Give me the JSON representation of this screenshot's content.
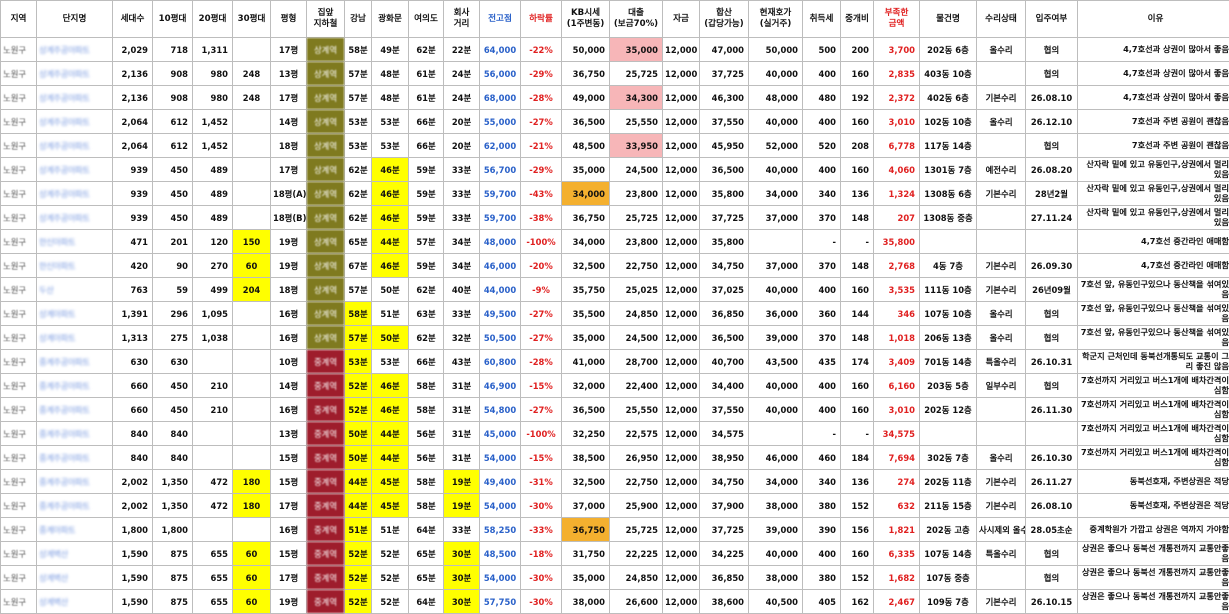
{
  "headers": [
    "지역",
    "단지명",
    "세대수",
    "10평대",
    "20평대",
    "30평대",
    "평형",
    "집앞\n지하철",
    "강남",
    "광화문",
    "여의도",
    "회사\n거리",
    "전고점",
    "하락률",
    "KB시세\n(1주변동)",
    "대출\n(보금70%)",
    "자금",
    "합산\n(갑당가능)",
    "현재호가\n(실거주)",
    "취득세",
    "중개비",
    "부족한\n금액",
    "물건명",
    "수리상태",
    "입주여부",
    "이유"
  ],
  "colors": {
    "yellow": "#ffff00",
    "pink": "#f7b6b8",
    "orange": "#f4b02f",
    "olive": "#7f7a1f",
    "maroon": "#9e1d2c",
    "blue": "#2a61c9",
    "red": "#e02020"
  },
  "rows": [
    {
      "region": "노원구",
      "name": "상계주공아파트",
      "households": "2,029",
      "p10": "718",
      "p20": "1,311",
      "p30": "",
      "size": "17평",
      "station": "상계역",
      "stationColor": "olive",
      "gangnam": "58분",
      "ghm": "49분",
      "ydo": "62분",
      "company": "22분",
      "peak": "64,000",
      "drop": "-22%",
      "kb": "50,000",
      "loan": "35,000",
      "fund": "12,000",
      "sum": "47,000",
      "ask": "50,000",
      "tax": "500",
      "fee": "200",
      "lack": "3,700",
      "item": "202동 6층",
      "repair": "올수리",
      "movein": "협의",
      "reason": "4,7호선과 상권이 많아서 좋음",
      "hl": {
        "loan": "pink"
      }
    },
    {
      "region": "노원구",
      "name": "상계주공아파트",
      "households": "2,136",
      "p10": "908",
      "p20": "980",
      "p30": "248",
      "size": "13평",
      "station": "상계역",
      "stationColor": "olive",
      "gangnam": "57분",
      "ghm": "48분",
      "ydo": "61분",
      "company": "24분",
      "peak": "56,000",
      "drop": "-29%",
      "kb": "36,750",
      "loan": "25,725",
      "fund": "12,000",
      "sum": "37,725",
      "ask": "40,000",
      "tax": "400",
      "fee": "160",
      "lack": "2,835",
      "item": "403동 10층",
      "repair": "",
      "movein": "협의",
      "reason": "4,7호선과 상권이 많아서 좋음",
      "hl": {}
    },
    {
      "region": "노원구",
      "name": "상계주공아파트",
      "households": "2,136",
      "p10": "908",
      "p20": "980",
      "p30": "248",
      "size": "17평",
      "station": "상계역",
      "stationColor": "olive",
      "gangnam": "57분",
      "ghm": "48분",
      "ydo": "61분",
      "company": "24분",
      "peak": "68,000",
      "drop": "-28%",
      "kb": "49,000",
      "loan": "34,300",
      "fund": "12,000",
      "sum": "46,300",
      "ask": "48,000",
      "tax": "480",
      "fee": "192",
      "lack": "2,372",
      "item": "402동 6층",
      "repair": "기본수리",
      "movein": "26.08.10",
      "reason": "4,7호선과 상권이 많아서 좋음",
      "hl": {
        "loan": "pink"
      }
    },
    {
      "region": "노원구",
      "name": "상계주공아파트",
      "households": "2,064",
      "p10": "612",
      "p20": "1,452",
      "p30": "",
      "size": "14평",
      "station": "상계역",
      "stationColor": "olive",
      "gangnam": "53분",
      "ghm": "53분",
      "ydo": "66분",
      "company": "20분",
      "peak": "55,000",
      "drop": "-27%",
      "kb": "36,500",
      "loan": "25,550",
      "fund": "12,000",
      "sum": "37,550",
      "ask": "40,000",
      "tax": "400",
      "fee": "160",
      "lack": "3,010",
      "item": "102동 10층",
      "repair": "올수리",
      "movein": "26.12.10",
      "reason": "7호선과 주변 공원이 괜찮음",
      "hl": {}
    },
    {
      "region": "노원구",
      "name": "상계주공아파트",
      "households": "2,064",
      "p10": "612",
      "p20": "1,452",
      "p30": "",
      "size": "18평",
      "station": "상계역",
      "stationColor": "olive",
      "gangnam": "53분",
      "ghm": "53분",
      "ydo": "66분",
      "company": "20분",
      "peak": "62,000",
      "drop": "-21%",
      "kb": "48,500",
      "loan": "33,950",
      "fund": "12,000",
      "sum": "45,950",
      "ask": "52,000",
      "tax": "520",
      "fee": "208",
      "lack": "6,778",
      "item": "117동 14층",
      "repair": "",
      "movein": "협의",
      "reason": "7호선과 주변 공원이 괜찮음",
      "hl": {
        "loan": "pink"
      }
    },
    {
      "region": "노원구",
      "name": "상계주공아파트",
      "households": "939",
      "p10": "450",
      "p20": "489",
      "p30": "",
      "size": "17평",
      "station": "상계역",
      "stationColor": "olive",
      "gangnam": "62분",
      "ghm": "46분",
      "ydo": "59분",
      "company": "33분",
      "peak": "56,700",
      "drop": "-29%",
      "kb": "35,000",
      "loan": "24,500",
      "fund": "12,000",
      "sum": "36,500",
      "ask": "40,000",
      "tax": "400",
      "fee": "160",
      "lack": "4,060",
      "item": "1301동 7층",
      "repair": "예전수리",
      "movein": "26.08.20",
      "reason": "산자락 밑에 있고 유동인구,상권에서 멀리있음",
      "hl": {
        "ghm": "yellow"
      }
    },
    {
      "region": "노원구",
      "name": "상계주공아파트",
      "households": "939",
      "p10": "450",
      "p20": "489",
      "p30": "",
      "size": "18평(A)",
      "station": "상계역",
      "stationColor": "olive",
      "gangnam": "62분",
      "ghm": "46분",
      "ydo": "59분",
      "company": "33분",
      "peak": "59,700",
      "drop": "-43%",
      "kb": "34,000",
      "loan": "23,800",
      "fund": "12,000",
      "sum": "35,800",
      "ask": "34,000",
      "tax": "340",
      "fee": "136",
      "lack": "1,324",
      "item": "1308동 6층",
      "repair": "기본수리",
      "movein": "28년2월",
      "reason": "산자락 밑에 있고 유동인구,상권에서 멀리있음",
      "hl": {
        "ghm": "yellow",
        "kb": "orange"
      }
    },
    {
      "region": "노원구",
      "name": "상계주공아파트",
      "households": "939",
      "p10": "450",
      "p20": "489",
      "p30": "",
      "size": "18평(B)",
      "station": "상계역",
      "stationColor": "olive",
      "gangnam": "62분",
      "ghm": "46분",
      "ydo": "59분",
      "company": "33분",
      "peak": "59,700",
      "drop": "-38%",
      "kb": "36,750",
      "loan": "25,725",
      "fund": "12,000",
      "sum": "37,725",
      "ask": "37,000",
      "tax": "370",
      "fee": "148",
      "lack": "207",
      "item": "1308동 중층",
      "repair": "",
      "movein": "27.11.24",
      "reason": "산자락 밑에 있고 유동인구,상권에서 멀리있음",
      "hl": {
        "ghm": "yellow"
      }
    },
    {
      "region": "노원구",
      "name": "한신아파트",
      "households": "471",
      "p10": "201",
      "p20": "120",
      "p30": "150",
      "size": "19평",
      "station": "상계역",
      "stationColor": "olive",
      "gangnam": "65분",
      "ghm": "44분",
      "ydo": "57분",
      "company": "34분",
      "peak": "48,000",
      "drop": "-100%",
      "kb": "34,000",
      "loan": "23,800",
      "fund": "12,000",
      "sum": "35,800",
      "ask": "",
      "tax": "-",
      "fee": "-",
      "lack": "35,800",
      "item": "",
      "repair": "",
      "movein": "",
      "reason": "4,7호선 중간라인 애매함",
      "hl": {
        "p30": "yellow",
        "ghm": "yellow"
      }
    },
    {
      "region": "노원구",
      "name": "한신아파트",
      "households": "420",
      "p10": "90",
      "p20": "270",
      "p30": "60",
      "size": "19평",
      "station": "상계역",
      "stationColor": "olive",
      "gangnam": "67분",
      "ghm": "46분",
      "ydo": "59분",
      "company": "34분",
      "peak": "46,000",
      "drop": "-20%",
      "kb": "32,500",
      "loan": "22,750",
      "fund": "12,000",
      "sum": "34,750",
      "ask": "37,000",
      "tax": "370",
      "fee": "148",
      "lack": "2,768",
      "item": "4동 7층",
      "repair": "기본수리",
      "movein": "26.09.30",
      "reason": "4,7호선 중간라인 애매함",
      "hl": {
        "p30": "yellow",
        "ghm": "yellow"
      }
    },
    {
      "region": "노원구",
      "name": "두산",
      "households": "763",
      "p10": "59",
      "p20": "499",
      "p30": "204",
      "size": "18평",
      "station": "상계역",
      "stationColor": "olive",
      "gangnam": "57분",
      "ghm": "50분",
      "ydo": "62분",
      "company": "40분",
      "peak": "44,000",
      "drop": "-9%",
      "kb": "35,750",
      "loan": "25,025",
      "fund": "12,000",
      "sum": "37,025",
      "ask": "40,000",
      "tax": "400",
      "fee": "160",
      "lack": "3,535",
      "item": "111동 10층",
      "repair": "기본수리",
      "movein": "26년09월",
      "reason": "7호선 앞, 유동인구있으나 동산책을 섞여있음",
      "hl": {
        "p30": "yellow"
      }
    },
    {
      "region": "노원구",
      "name": "상계아파트",
      "households": "1,391",
      "p10": "296",
      "p20": "1,095",
      "p30": "",
      "size": "16평",
      "station": "상계역",
      "stationColor": "olive",
      "gangnam": "58분",
      "ghm": "51분",
      "ydo": "63분",
      "company": "33분",
      "peak": "49,500",
      "drop": "-27%",
      "kb": "35,500",
      "loan": "24,850",
      "fund": "12,000",
      "sum": "36,850",
      "ask": "36,000",
      "tax": "360",
      "fee": "144",
      "lack": "346",
      "item": "107동 10층",
      "repair": "올수리",
      "movein": "협의",
      "reason": "7호선 앞, 유동인구있으나 동산책을 섞여있음",
      "hl": {
        "gangnam": "yellow"
      }
    },
    {
      "region": "노원구",
      "name": "상계아파트",
      "households": "1,313",
      "p10": "275",
      "p20": "1,038",
      "p30": "",
      "size": "16평",
      "station": "상계역",
      "stationColor": "olive",
      "gangnam": "57분",
      "ghm": "50분",
      "ydo": "62분",
      "company": "32분",
      "peak": "50,500",
      "drop": "-27%",
      "kb": "35,000",
      "loan": "24,500",
      "fund": "12,000",
      "sum": "36,500",
      "ask": "39,000",
      "tax": "370",
      "fee": "148",
      "lack": "1,018",
      "item": "206동 13층",
      "repair": "올수리",
      "movein": "협의",
      "reason": "7호선 앞, 유동인구있으나 동산책을 섞여있음",
      "hl": {
        "gangnam": "yellow",
        "ghm": "yellow"
      }
    },
    {
      "region": "노원구",
      "name": "중계주공아파트",
      "households": "630",
      "p10": "630",
      "p20": "",
      "p30": "",
      "size": "10평",
      "station": "중계역",
      "stationColor": "red",
      "gangnam": "53분",
      "ghm": "53분",
      "ydo": "66분",
      "company": "43분",
      "peak": "60,800",
      "drop": "-28%",
      "kb": "41,000",
      "loan": "28,700",
      "fund": "12,000",
      "sum": "40,700",
      "ask": "43,500",
      "tax": "435",
      "fee": "174",
      "lack": "3,409",
      "item": "701동 14층",
      "repair": "특올수리",
      "movein": "26.10.31",
      "reason": "학군지 근처인데 동북선개통되도 교통이 그리 좋진 않음",
      "hl": {
        "gangnam": "yellow"
      }
    },
    {
      "region": "노원구",
      "name": "중계주공아파트",
      "households": "660",
      "p10": "450",
      "p20": "210",
      "p30": "",
      "size": "14평",
      "station": "중계역",
      "stationColor": "red",
      "gangnam": "52분",
      "ghm": "46분",
      "ydo": "58분",
      "company": "31분",
      "peak": "46,900",
      "drop": "-15%",
      "kb": "32,000",
      "loan": "22,400",
      "fund": "12,000",
      "sum": "34,400",
      "ask": "40,000",
      "tax": "400",
      "fee": "160",
      "lack": "6,160",
      "item": "203동 5층",
      "repair": "일부수리",
      "movein": "협의",
      "reason": "7호선까지 거리있고 버스1개에 배차간격이 심함",
      "hl": {
        "gangnam": "yellow",
        "ghm": "yellow"
      }
    },
    {
      "region": "노원구",
      "name": "중계주공아파트",
      "households": "660",
      "p10": "450",
      "p20": "210",
      "p30": "",
      "size": "16평",
      "station": "중계역",
      "stationColor": "red",
      "gangnam": "52분",
      "ghm": "46분",
      "ydo": "58분",
      "company": "31분",
      "peak": "54,800",
      "drop": "-27%",
      "kb": "36,500",
      "loan": "25,550",
      "fund": "12,000",
      "sum": "37,550",
      "ask": "40,000",
      "tax": "400",
      "fee": "160",
      "lack": "3,010",
      "item": "202동 12층",
      "repair": "",
      "movein": "26.11.30",
      "reason": "7호선까지 거리있고 버스1개에 배차간격이 심함",
      "hl": {
        "gangnam": "yellow",
        "ghm": "yellow"
      }
    },
    {
      "region": "노원구",
      "name": "중계주공아파트",
      "households": "840",
      "p10": "840",
      "p20": "",
      "p30": "",
      "size": "13평",
      "station": "중계역",
      "stationColor": "red",
      "gangnam": "50분",
      "ghm": "44분",
      "ydo": "56분",
      "company": "31분",
      "peak": "45,000",
      "drop": "-100%",
      "kb": "32,250",
      "loan": "22,575",
      "fund": "12,000",
      "sum": "34,575",
      "ask": "",
      "tax": "-",
      "fee": "-",
      "lack": "34,575",
      "item": "",
      "repair": "",
      "movein": "",
      "reason": "7호선까지 거리있고 버스1개에 배차간격이 심함",
      "hl": {
        "gangnam": "yellow",
        "ghm": "yellow"
      }
    },
    {
      "region": "노원구",
      "name": "중계주공아파트",
      "households": "840",
      "p10": "840",
      "p20": "",
      "p30": "",
      "size": "15평",
      "station": "중계역",
      "stationColor": "red",
      "gangnam": "50분",
      "ghm": "44분",
      "ydo": "56분",
      "company": "31분",
      "peak": "54,000",
      "drop": "-15%",
      "kb": "38,500",
      "loan": "26,950",
      "fund": "12,000",
      "sum": "38,950",
      "ask": "46,000",
      "tax": "460",
      "fee": "184",
      "lack": "7,694",
      "item": "302동 7층",
      "repair": "올수리",
      "movein": "26.10.30",
      "reason": "7호선까지 거리있고 버스1개에 배차간격이 심함",
      "hl": {
        "gangnam": "yellow",
        "ghm": "yellow"
      }
    },
    {
      "region": "노원구",
      "name": "중계주공아파트",
      "households": "2,002",
      "p10": "1,350",
      "p20": "472",
      "p30": "180",
      "size": "15평",
      "station": "중계역",
      "stationColor": "red",
      "gangnam": "44분",
      "ghm": "45분",
      "ydo": "58분",
      "company": "19분",
      "peak": "49,400",
      "drop": "-31%",
      "kb": "32,500",
      "loan": "22,750",
      "fund": "12,000",
      "sum": "34,750",
      "ask": "34,000",
      "tax": "340",
      "fee": "136",
      "lack": "274",
      "item": "202동 11층",
      "repair": "기본수리",
      "movein": "26.11.27",
      "reason": "동북선호재, 주변상권은 적당",
      "hl": {
        "p30": "yellow",
        "gangnam": "yellow",
        "ghm": "yellow",
        "company": "yellow"
      }
    },
    {
      "region": "노원구",
      "name": "중계주공아파트",
      "households": "2,002",
      "p10": "1,350",
      "p20": "472",
      "p30": "180",
      "size": "17평",
      "station": "중계역",
      "stationColor": "red",
      "gangnam": "44분",
      "ghm": "45분",
      "ydo": "58분",
      "company": "19분",
      "peak": "54,000",
      "drop": "-30%",
      "kb": "37,000",
      "loan": "25,900",
      "fund": "12,000",
      "sum": "37,900",
      "ask": "38,000",
      "tax": "380",
      "fee": "152",
      "lack": "632",
      "item": "211동 15층",
      "repair": "기본수리",
      "movein": "26.08.10",
      "reason": "동북선호재, 주변상권은 적당",
      "hl": {
        "p30": "yellow",
        "gangnam": "yellow",
        "ghm": "yellow",
        "company": "yellow"
      }
    },
    {
      "region": "노원구",
      "name": "중계아파트",
      "households": "1,800",
      "p10": "1,800",
      "p20": "",
      "p30": "",
      "size": "16평",
      "station": "중계역",
      "stationColor": "red",
      "gangnam": "51분",
      "ghm": "51분",
      "ydo": "64분",
      "company": "33분",
      "peak": "58,250",
      "drop": "-33%",
      "kb": "36,750",
      "loan": "25,725",
      "fund": "12,000",
      "sum": "37,725",
      "ask": "39,000",
      "tax": "390",
      "fee": "156",
      "lack": "1,821",
      "item": "202동 고층",
      "repair": "사시제외 올수리",
      "movein": "28.05초순",
      "reason": "중계학원가 가깝고 상권은 역까지 가야함",
      "hl": {
        "gangnam": "yellow",
        "kb": "orange"
      }
    },
    {
      "region": "노원구",
      "name": "상계벽산",
      "households": "1,590",
      "p10": "875",
      "p20": "655",
      "p30": "60",
      "size": "15평",
      "station": "중계역",
      "stationColor": "red",
      "gangnam": "52분",
      "ghm": "52분",
      "ydo": "65분",
      "company": "30분",
      "peak": "48,500",
      "drop": "-18%",
      "kb": "31,750",
      "loan": "22,225",
      "fund": "12,000",
      "sum": "34,225",
      "ask": "40,000",
      "tax": "400",
      "fee": "160",
      "lack": "6,335",
      "item": "107동 14층",
      "repair": "특올수리",
      "movein": "협의",
      "reason": "상권은 좋으나 동북선 개통전까지 교통안좋음",
      "hl": {
        "p30": "yellow",
        "gangnam": "yellow",
        "company": "yellow"
      }
    },
    {
      "region": "노원구",
      "name": "상계벽산",
      "households": "1,590",
      "p10": "875",
      "p20": "655",
      "p30": "60",
      "size": "17평",
      "station": "중계역",
      "stationColor": "red",
      "gangnam": "52분",
      "ghm": "52분",
      "ydo": "65분",
      "company": "30분",
      "peak": "54,000",
      "drop": "-30%",
      "kb": "35,000",
      "loan": "24,850",
      "fund": "12,000",
      "sum": "36,850",
      "ask": "38,000",
      "tax": "380",
      "fee": "152",
      "lack": "1,682",
      "item": "107동 중층",
      "repair": "",
      "movein": "협의",
      "reason": "상권은 좋으나 동북선 개통전까지 교통안좋음",
      "hl": {
        "p30": "yellow",
        "gangnam": "yellow",
        "company": "yellow"
      }
    },
    {
      "region": "노원구",
      "name": "상계벽산",
      "households": "1,590",
      "p10": "875",
      "p20": "655",
      "p30": "60",
      "size": "19평",
      "station": "중계역",
      "stationColor": "red",
      "gangnam": "52분",
      "ghm": "52분",
      "ydo": "64분",
      "company": "30분",
      "peak": "57,750",
      "drop": "-30%",
      "kb": "38,000",
      "loan": "26,600",
      "fund": "12,000",
      "sum": "38,600",
      "ask": "40,500",
      "tax": "405",
      "fee": "162",
      "lack": "2,467",
      "item": "109동 7층",
      "repair": "기본수리",
      "movein": "26.10.15",
      "reason": "상권은 좋으나 동북선 개통전까지 교통안좋음",
      "hl": {
        "p30": "yellow",
        "gangnam": "yellow",
        "company": "yellow"
      }
    }
  ]
}
